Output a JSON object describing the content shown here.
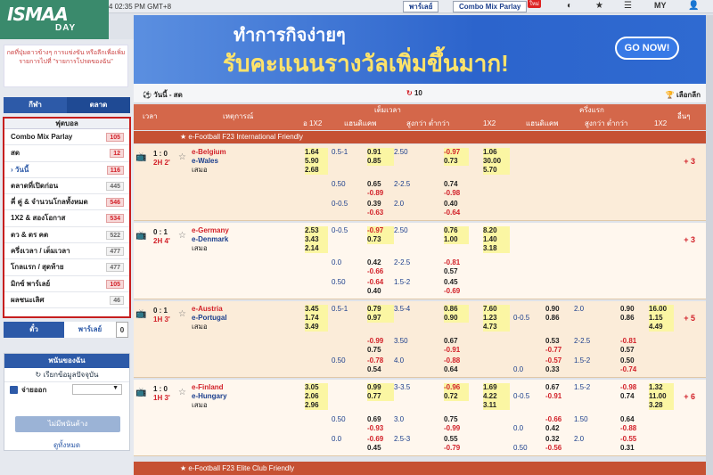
{
  "top": {
    "time": "4 02:35 PM GMT+8",
    "btn1": "พาร์เลย์",
    "btn2": "Combo Mix Parlay",
    "new": "ใหม่",
    "lang": "MY"
  },
  "logo": {
    "l1": "ISMAA",
    "l2": "DAY"
  },
  "side": {
    "hint": "กดที่ปุ่มดาวข้างๆ การแข่งขัน หรือลีกเพื่อเพิ่มรายการไปที่ \"รายการโปรดของฉัน\"",
    "tab1": "กีฬา",
    "tab2": "ตลาด",
    "sport_title": "ฟุตบอล",
    "items": [
      {
        "label": "Combo Mix Parlay",
        "count": "105",
        "hot": true
      },
      {
        "label": "สด",
        "count": "12",
        "hot": true
      },
      {
        "label": "› วันนี้",
        "count": "116",
        "hot": true
      },
      {
        "label": "ตลาดที่เปิดก่อน",
        "count": "445",
        "hot": false
      },
      {
        "label": "คี่ คู่ & จำนวนโกลทั้งหมด",
        "count": "546",
        "hot": true
      },
      {
        "label": "1X2 & สองโอกาส",
        "count": "534",
        "hot": true
      },
      {
        "label": "ตว & ตร คต",
        "count": "522",
        "hot": false
      },
      {
        "label": "ครึ่งเวลา / เต็มเวลา",
        "count": "477",
        "hot": false
      },
      {
        "label": "โกลแรก / สุดท้าย",
        "count": "477",
        "hot": false
      },
      {
        "label": "มิกซ์ พาร์เลย์",
        "count": "105",
        "hot": true
      },
      {
        "label": "ผลชนะเลิศ",
        "count": "46",
        "hot": false
      }
    ],
    "btab1": "ตั๋ว",
    "btab2": "พาร์เลย์",
    "btab2_count": "0",
    "bet_title": "พนันของฉัน",
    "bet_refresh": "เรียกข้อมูลปัจจุบัน",
    "bet_paid": "จ่ายออก",
    "bet_btn": "ไม่มีพนันค้าง",
    "bet_all": "ดูทั้งหมด"
  },
  "banner": {
    "line1": "ทำการกิจง่ายๆ",
    "line2": "รับคะแนนรางวัลเพิ่มขึ้นมาก!",
    "go": "GO NOW!"
  },
  "ctrl": {
    "left": "วันนี้ - สด",
    "mid": "10",
    "right": "เลือกลีก"
  },
  "head": {
    "time": "เวลา",
    "event": "เหตุการณ์",
    "full": "เต็มเวลา",
    "half": "ครึ่งแรก",
    "x12": "อ 1X2",
    "hdp": "แฮนดิแคพ",
    "ou": "สูงกว่า ต่ำกว่า",
    "x12b": "1X2",
    "hdp2": "แฮนดิแคพ",
    "ou2": "สูงกว่า ต่ำกว่า",
    "x12c": "1X2",
    "more": "อื่นๆ"
  },
  "leagues": [
    "e-Football F23 International Friendly",
    "e-Football F23 Elite Club Friendly"
  ],
  "matches": [
    {
      "score": "1 : 0",
      "time": "2H 2'",
      "home": "e-Belgium",
      "away": "e-Wales",
      "draw": "เสมอ",
      "more": "+ 3",
      "x12": [
        "1.64",
        "5.90",
        "2.68"
      ],
      "hdp_line": "0.5-1",
      "hdp": [
        "0.91",
        "0.85"
      ],
      "ou_line": "2.50",
      "ou": [
        "-0.97",
        "0.73"
      ],
      "x": [
        "1.06",
        "30.00",
        "5.70"
      ],
      "alt": [
        {
          "hl": "0.50",
          "h": [
            "0.65",
            "-0.89"
          ],
          "ol": "2-2.5",
          "o": [
            "0.74",
            "-0.98"
          ]
        },
        {
          "hl": "0-0.5",
          "h": [
            "0.39",
            "-0.63"
          ],
          "ol": "2.0",
          "o": [
            "0.40",
            "-0.64"
          ]
        }
      ]
    },
    {
      "score": "0 : 1",
      "time": "2H 4'",
      "home": "e-Germany",
      "away": "e-Denmark",
      "draw": "เสมอ",
      "more": "+ 3",
      "x12": [
        "2.53",
        "3.43",
        "2.14"
      ],
      "hdp_line": "0-0.5",
      "hdp": [
        "-0.97",
        "0.73"
      ],
      "ou_line": "2.50",
      "ou": [
        "0.76",
        "1.00"
      ],
      "x": [
        "8.20",
        "1.40",
        "3.18"
      ],
      "alt": [
        {
          "hl": "0.0",
          "h": [
            "0.42",
            "-0.66"
          ],
          "ol": "2-2.5",
          "o": [
            "-0.81",
            "0.57"
          ]
        },
        {
          "hl": "0.50",
          "h": [
            "-0.64",
            "0.40"
          ],
          "ol": "1.5-2",
          "o": [
            "0.45",
            "-0.69"
          ]
        }
      ]
    },
    {
      "score": "0 : 1",
      "time": "1H 3'",
      "home": "e-Austria",
      "away": "e-Portugal",
      "draw": "เสมอ",
      "more": "+ 5",
      "x12": [
        "3.45",
        "1.74",
        "3.49"
      ],
      "hdp_line": "0.5-1",
      "hdp": [
        "0.79",
        "0.97"
      ],
      "ou_line": "3.5-4",
      "ou": [
        "0.86",
        "0.90"
      ],
      "x": [
        "7.60",
        "1.23",
        "4.73"
      ],
      "h_line": "0-0.5",
      "h": [
        "0.90",
        "0.86"
      ],
      "h_ol": "2.0",
      "h_o": [
        "0.90",
        "0.86"
      ],
      "hx": [
        "16.00",
        "1.15",
        "4.49"
      ],
      "alt": [
        {
          "hl": "",
          "h": [
            "-0.99",
            "0.75"
          ],
          "ol": "3.50",
          "o": [
            "0.67",
            "-0.91"
          ],
          "hh": [
            "0.53",
            "-0.77"
          ],
          "hol": "2-2.5",
          "ho": [
            "-0.81",
            "0.57"
          ]
        },
        {
          "hl": "0.50",
          "h": [
            "-0.78",
            "0.54"
          ],
          "ol": "4.0",
          "o": [
            "-0.88",
            "0.64"
          ],
          "hh": [
            "-0.57",
            "0.33"
          ],
          "hhl": "0.0",
          "hol": "1.5-2",
          "ho": [
            "0.50",
            "-0.74"
          ]
        }
      ]
    },
    {
      "score": "1 : 0",
      "time": "1H 3'",
      "home": "e-Finland",
      "away": "e-Hungary",
      "draw": "เสมอ",
      "more": "+ 6",
      "x12": [
        "3.05",
        "2.06",
        "2.96"
      ],
      "hdp_line": "",
      "hdp": [
        "0.99",
        "0.77"
      ],
      "ou_line": "3-3.5",
      "ou": [
        "-0.96",
        "0.72"
      ],
      "x": [
        "1.69",
        "4.22",
        "3.11"
      ],
      "h_line": "0-0.5",
      "h": [
        "0.67",
        "-0.91"
      ],
      "h_ol": "1.5-2",
      "h_o": [
        "-0.98",
        "0.74"
      ],
      "hx": [
        "1.32",
        "11.00",
        "3.28"
      ],
      "alt": [
        {
          "hl": "0.50",
          "h": [
            "0.69",
            "-0.93"
          ],
          "ol": "3.0",
          "o": [
            "0.75",
            "-0.99"
          ],
          "hh": [
            "-0.66",
            "0.42"
          ],
          "hhl": "0.0",
          "hol": "1.50",
          "ho": [
            "0.64",
            "-0.88"
          ]
        },
        {
          "hl": "0.0",
          "h": [
            "-0.69",
            "0.45"
          ],
          "ol": "2.5-3",
          "o": [
            "0.55",
            "-0.79"
          ],
          "hh": [
            "0.32",
            "-0.56"
          ],
          "hhl": "0.50",
          "hol": "2.0",
          "ho": [
            "-0.55",
            "0.31"
          ]
        }
      ]
    }
  ]
}
